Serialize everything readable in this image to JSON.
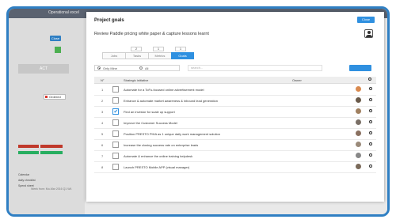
{
  "backdrop": {
    "title": "Operational excel",
    "close_label": "Close",
    "act_label": "ACT",
    "ordered_label": "Ordered",
    "list": [
      "Calendar",
      "daily checklist",
      "Spend sheet"
    ],
    "footer": "Week from: Mo-Mar 2016 Q1 W4"
  },
  "modal": {
    "title": "Project goals",
    "close_label": "Close",
    "goal_title": "Review Paddle pricing white paper & capture lessons learnt",
    "counts": [
      "2",
      "1",
      "1"
    ],
    "tabs": [
      {
        "label": "Jobs",
        "active": false
      },
      {
        "label": "Tasks",
        "active": false
      },
      {
        "label": "Metrics",
        "active": false
      },
      {
        "label": "Goals",
        "active": true
      }
    ],
    "filter": {
      "option_a": "Only Mine",
      "option_b": "All",
      "search_placeholder": "search...",
      "search_button": ""
    },
    "table_headers": {
      "num": "N°",
      "initiative": "Strategic initiative",
      "owner": "Owner"
    },
    "rows": [
      {
        "num": "1",
        "checked": false,
        "text": "Automate for a ToFu-focused online advertisement model",
        "avatar": "#d98a4f"
      },
      {
        "num": "2",
        "checked": false,
        "text": "Enhance & automate market awareness & inbound lead generation",
        "avatar": "#6a5a4a"
      },
      {
        "num": "3",
        "checked": true,
        "text": "Find an investor for scale up support",
        "avatar": "#a08060"
      },
      {
        "num": "4",
        "checked": false,
        "text": "Improve the Customer Success Model",
        "avatar": "#7a6f66"
      },
      {
        "num": "5",
        "checked": false,
        "text": "Position PRESTO PHIA as 1 unique daily work management solution",
        "avatar": "#8a7060"
      },
      {
        "num": "6",
        "checked": false,
        "text": "Increase the closing success rate on enterprise leads",
        "avatar": "#9a8a7a"
      },
      {
        "num": "7",
        "checked": false,
        "text": "Automate & enhance the online training helpdesk",
        "avatar": "#888888"
      },
      {
        "num": "8",
        "checked": false,
        "text": "Launch PRESTO Mobile APP (visual manager)",
        "avatar": "#7a6a5a"
      }
    ]
  }
}
